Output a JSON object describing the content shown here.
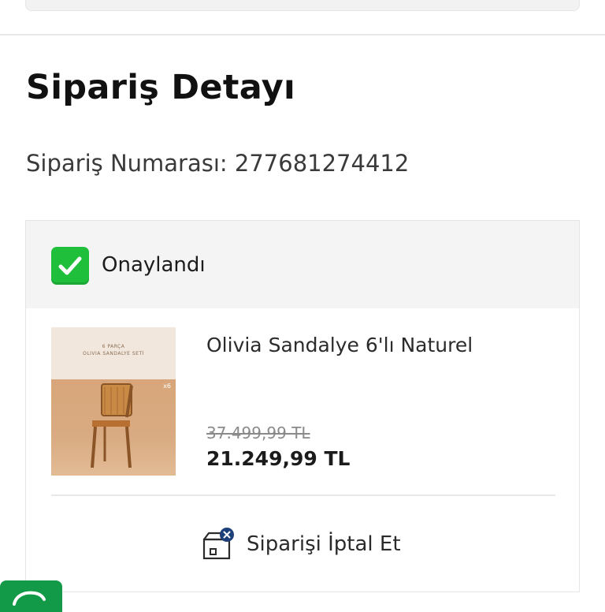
{
  "header": {
    "title": "Sipariş Detayı"
  },
  "order": {
    "number_text": "Sipariş Numarası: 277681274412",
    "status": {
      "label": "Onaylandı",
      "icon": "check-icon",
      "color": "#1fbf3b"
    },
    "item": {
      "image_caption": "6 PARÇA\nOLIVIA SANDALYE SETİ",
      "image_badge": "x6",
      "name": "Olivia Sandalye 6'lı Naturel",
      "old_price": "37.499,99 TL",
      "price": "21.249,99 TL"
    },
    "cancel": {
      "label": "Siparişi İptal Et",
      "icon": "cancel-order-icon"
    }
  },
  "colors": {
    "accent_green": "#129a48",
    "success": "#1fbf3b"
  }
}
